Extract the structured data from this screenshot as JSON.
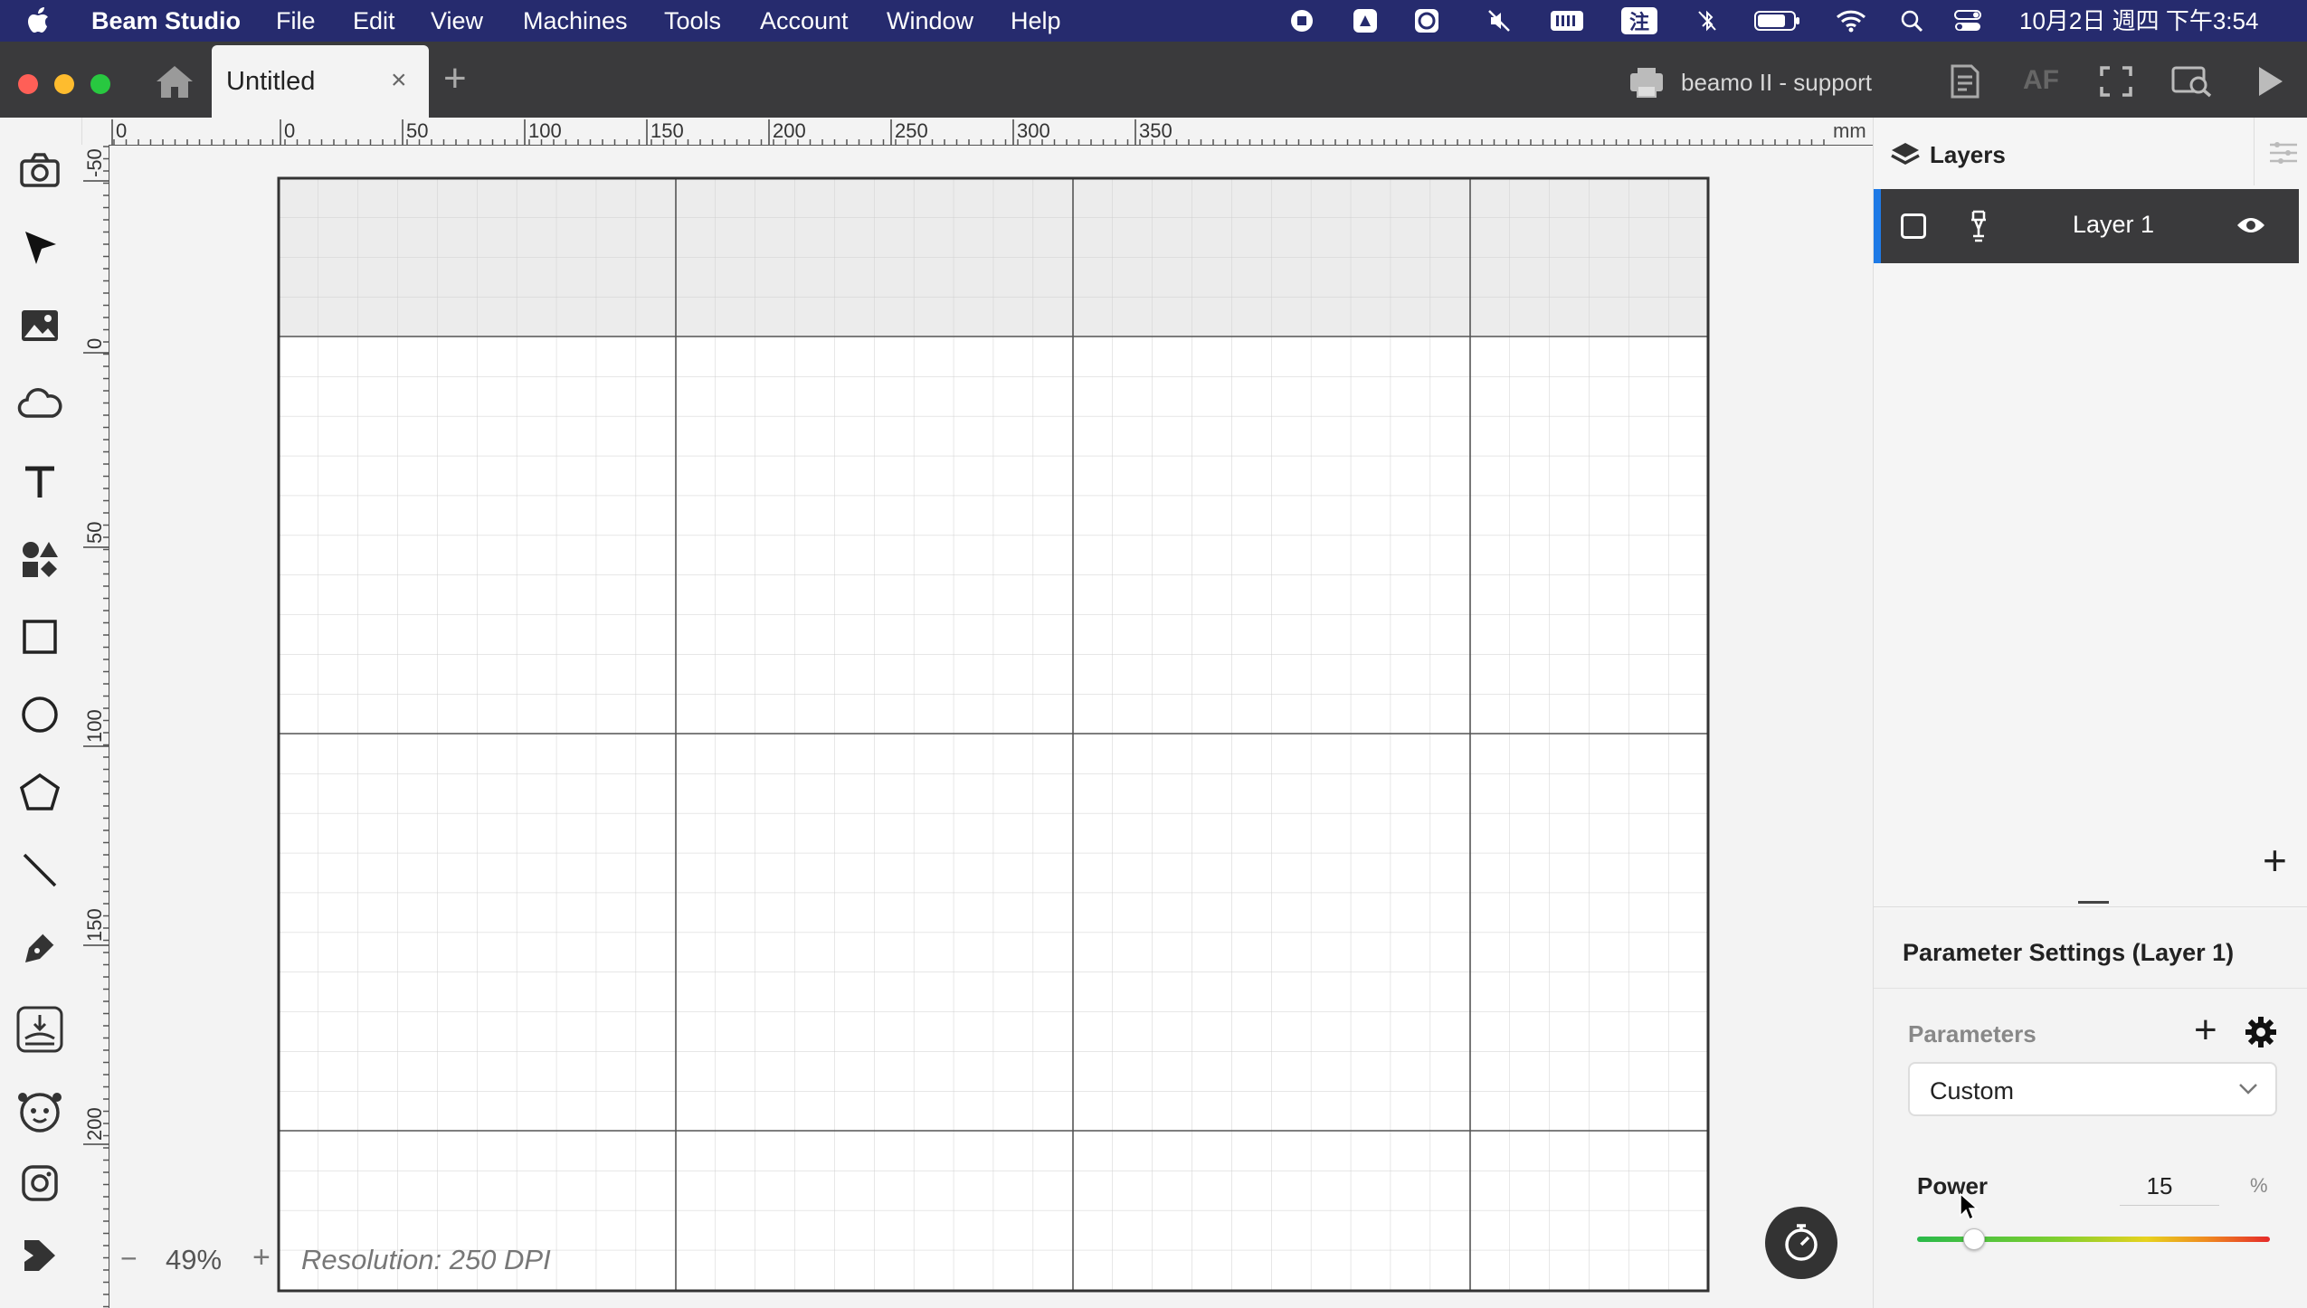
{
  "menubar": {
    "app_name": "Beam Studio",
    "menus": [
      "File",
      "Edit",
      "View",
      "Machines",
      "Tools",
      "Account",
      "Window",
      "Help"
    ],
    "input_method": "注",
    "datetime": "10月2日 週四 下午3:54"
  },
  "tabs": {
    "active_title": "Untitled",
    "close_glyph": "×",
    "new_tab_glyph": "+"
  },
  "header": {
    "device_name": "beamo II - support",
    "af_label": "AF"
  },
  "ruler": {
    "unit": "mm",
    "top_labels": [
      "0",
      "0",
      "50",
      "100",
      "150",
      "200",
      "250",
      "300",
      "350"
    ],
    "left_labels": [
      "-50",
      "0",
      "50",
      "100",
      "150",
      "200"
    ]
  },
  "toolbar": {
    "tools": [
      "camera-icon",
      "select-arrow-icon",
      "image-icon",
      "cloud-icon",
      "text-icon",
      "elements-icon",
      "rectangle-icon",
      "ellipse-icon",
      "polygon-icon",
      "line-icon",
      "pen-icon",
      "curve-engrave-icon",
      "beamy-icon",
      "instagram-icon",
      "design-market-icon"
    ]
  },
  "zoom": {
    "minus": "−",
    "value": "49%",
    "plus": "+",
    "resolution": "Resolution: 250 DPI"
  },
  "layers": {
    "title": "Layers",
    "items": [
      {
        "name": "Layer 1",
        "visible": true
      }
    ],
    "add_glyph": "+"
  },
  "params": {
    "title": "Parameter Settings (Layer 1)",
    "label": "Parameters",
    "preset": "Custom",
    "power_label": "Power",
    "power_value": "15",
    "power_unit": "%",
    "power_fraction": 0.15
  },
  "colors": {
    "menubar_bg": "#262b6e",
    "tabbar_bg": "#3a3a3c",
    "accent": "#1e7ae6",
    "layer_selected_bg": "#3a3a3c"
  }
}
